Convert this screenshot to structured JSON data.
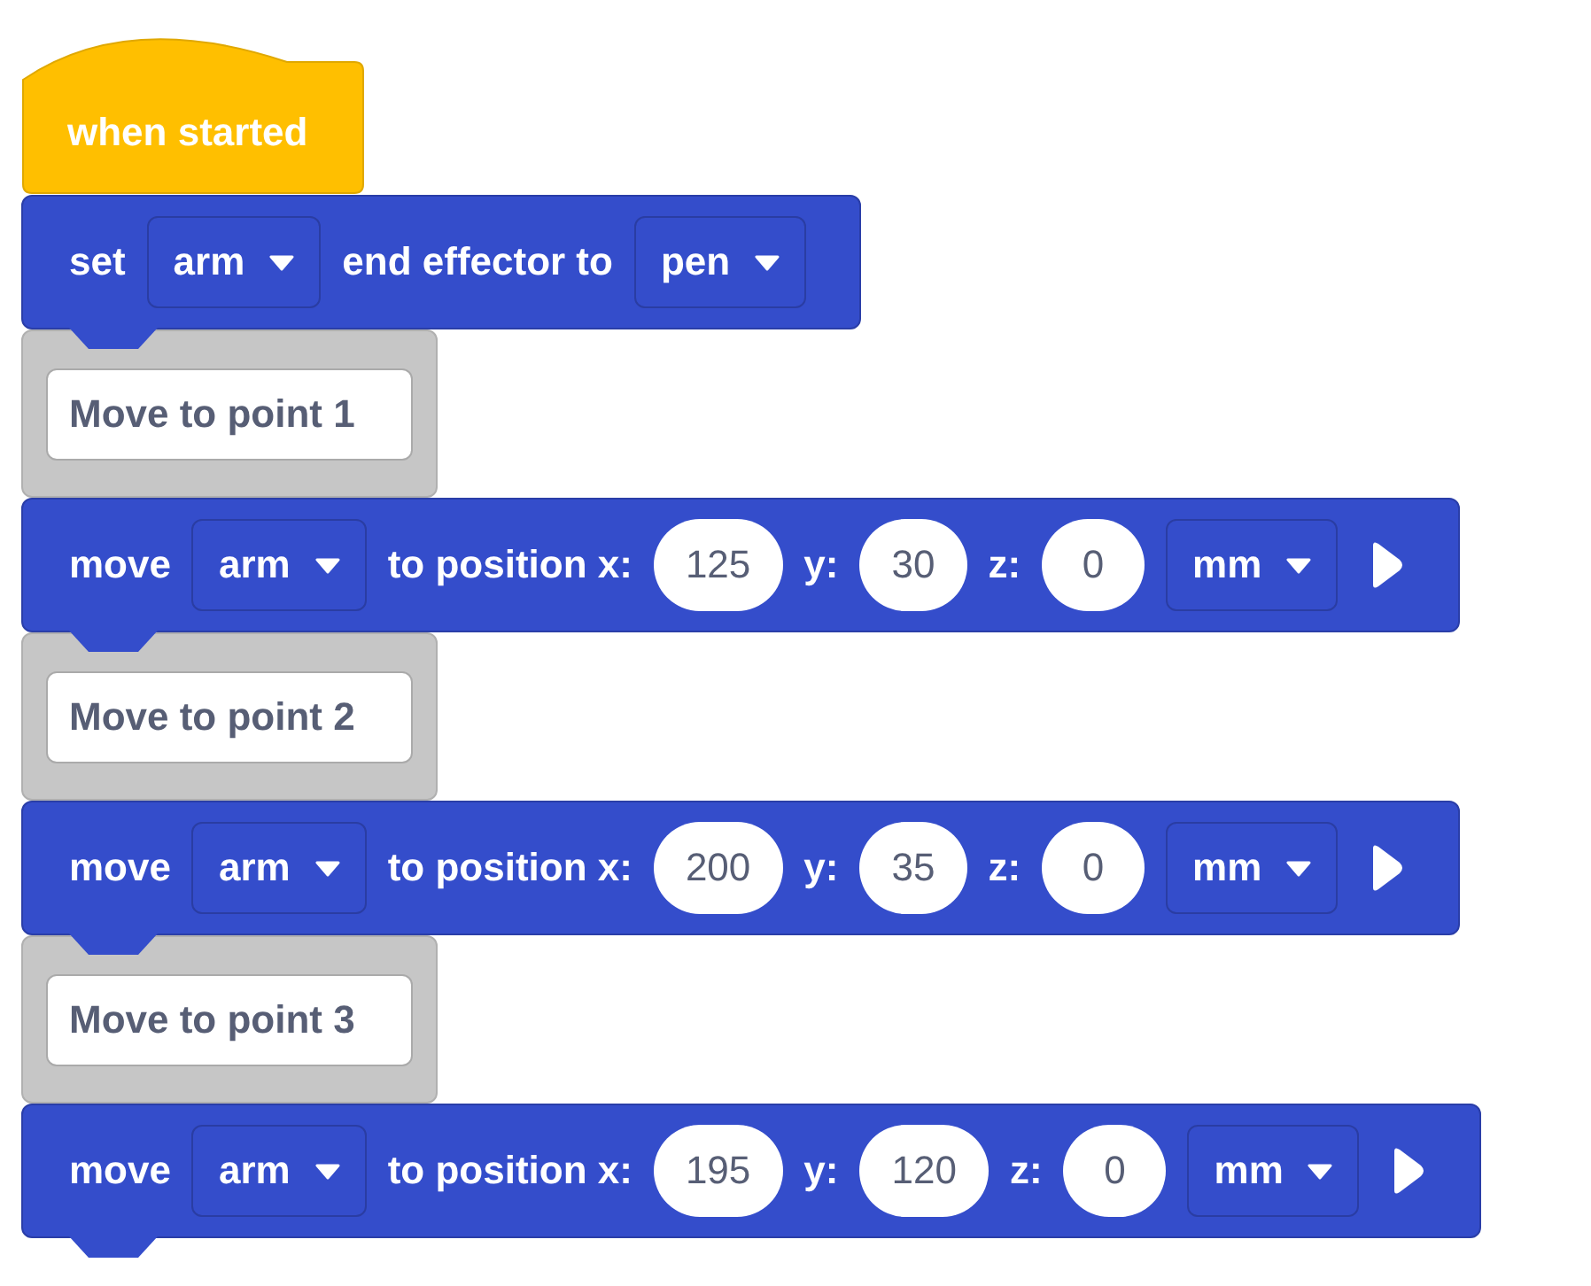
{
  "blocks": [
    {
      "kind": "hat",
      "text": "when started"
    },
    {
      "kind": "command",
      "parts": [
        {
          "kind": "label",
          "text": "set"
        },
        {
          "kind": "dropdown",
          "text": "arm"
        },
        {
          "kind": "label",
          "text": "end effector to"
        },
        {
          "kind": "dropdown",
          "text": "pen"
        }
      ]
    },
    {
      "kind": "comment",
      "text": "Move to point 1"
    },
    {
      "kind": "command",
      "parts": [
        {
          "kind": "label",
          "text": "move"
        },
        {
          "kind": "dropdown",
          "text": "arm"
        },
        {
          "kind": "label",
          "text": "to position x:"
        },
        {
          "kind": "number",
          "text": "125"
        },
        {
          "kind": "label",
          "text": "y:"
        },
        {
          "kind": "number",
          "text": "30"
        },
        {
          "kind": "label",
          "text": "z:"
        },
        {
          "kind": "number",
          "text": "0"
        },
        {
          "kind": "dropdown",
          "text": "mm"
        },
        {
          "kind": "expand"
        }
      ]
    },
    {
      "kind": "comment",
      "text": "Move to point 2"
    },
    {
      "kind": "command",
      "parts": [
        {
          "kind": "label",
          "text": "move"
        },
        {
          "kind": "dropdown",
          "text": "arm"
        },
        {
          "kind": "label",
          "text": "to position x:"
        },
        {
          "kind": "number",
          "text": "200"
        },
        {
          "kind": "label",
          "text": "y:"
        },
        {
          "kind": "number",
          "text": "35"
        },
        {
          "kind": "label",
          "text": "z:"
        },
        {
          "kind": "number",
          "text": "0"
        },
        {
          "kind": "dropdown",
          "text": "mm"
        },
        {
          "kind": "expand"
        }
      ]
    },
    {
      "kind": "comment",
      "text": "Move to point 3"
    },
    {
      "kind": "command",
      "parts": [
        {
          "kind": "label",
          "text": "move"
        },
        {
          "kind": "dropdown",
          "text": "arm"
        },
        {
          "kind": "label",
          "text": "to position x:"
        },
        {
          "kind": "number",
          "text": "195"
        },
        {
          "kind": "label",
          "text": "y:"
        },
        {
          "kind": "number",
          "text": "120"
        },
        {
          "kind": "label",
          "text": "z:"
        },
        {
          "kind": "number",
          "text": "0"
        },
        {
          "kind": "dropdown",
          "text": "mm"
        },
        {
          "kind": "expand"
        }
      ]
    }
  ]
}
